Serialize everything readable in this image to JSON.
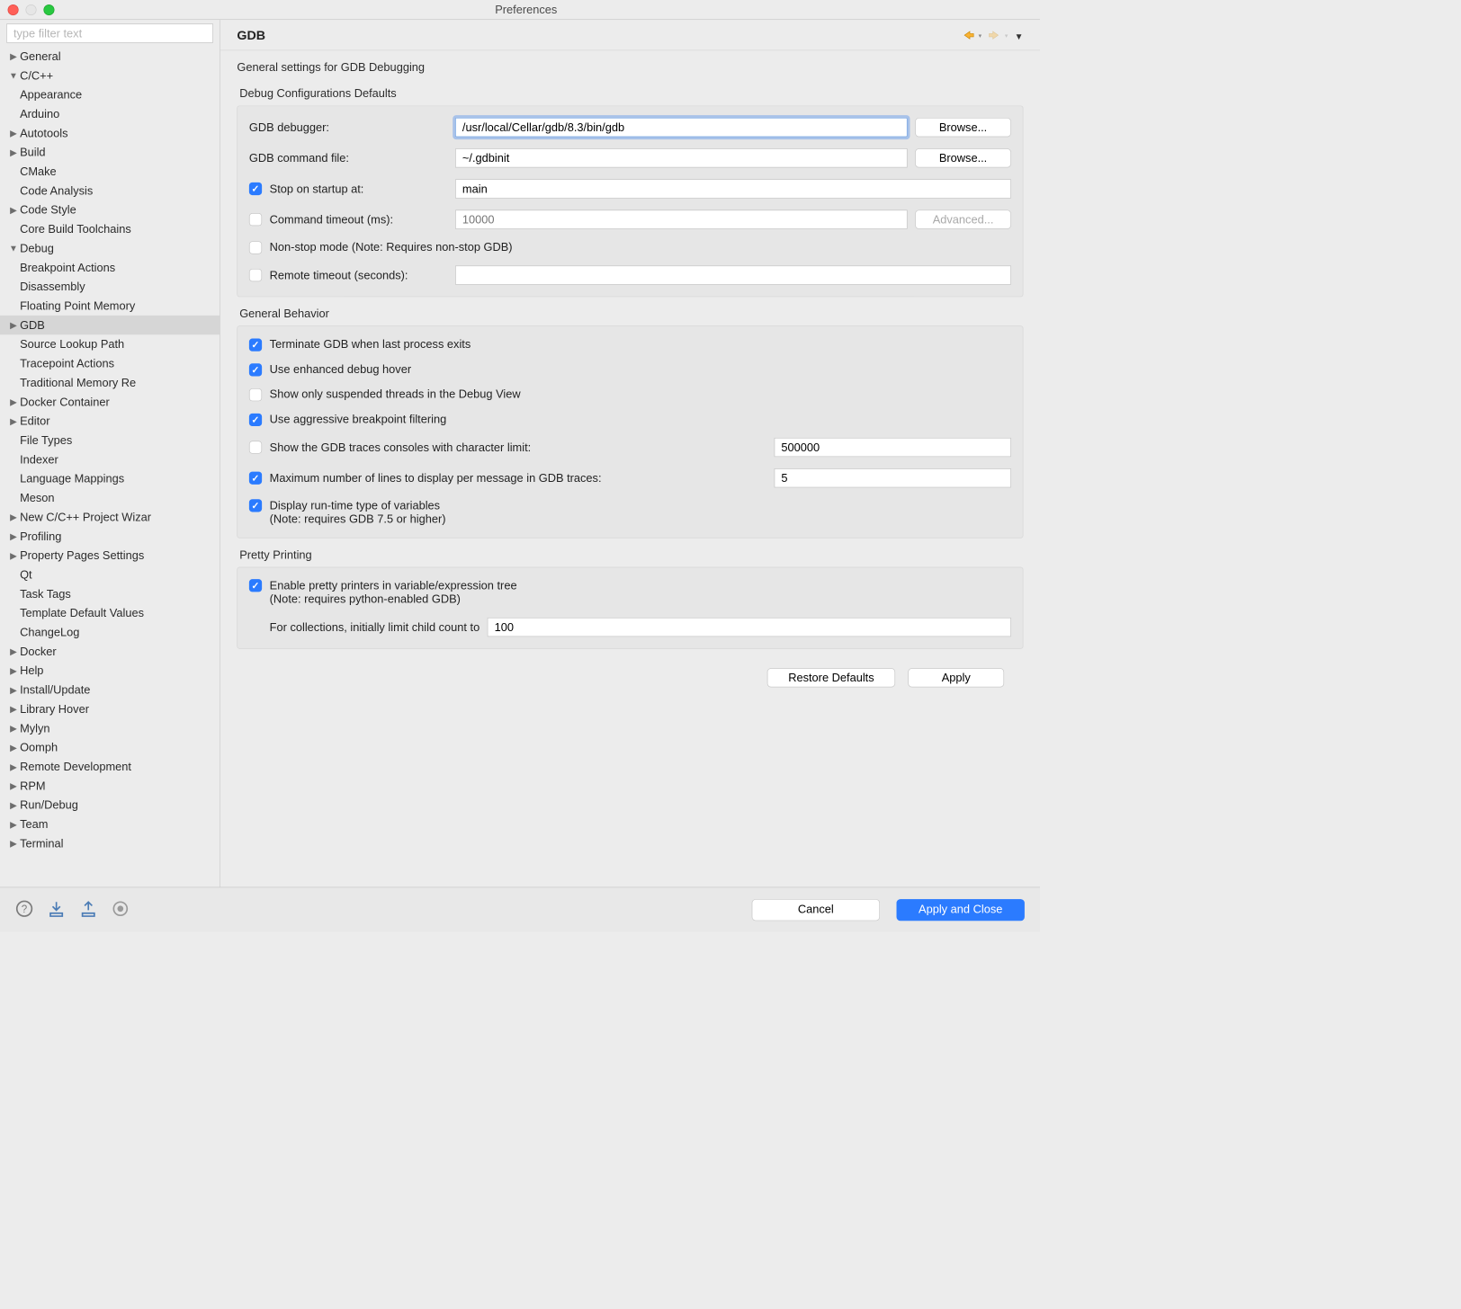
{
  "window_title": "Preferences",
  "filter_placeholder": "type filter text",
  "sidebar": {
    "items": [
      {
        "label": "General",
        "depth": 0,
        "arrow": "right"
      },
      {
        "label": "C/C++",
        "depth": 0,
        "arrow": "down"
      },
      {
        "label": "Appearance",
        "depth": 1,
        "arrow": "none"
      },
      {
        "label": "Arduino",
        "depth": 1,
        "arrow": "none"
      },
      {
        "label": "Autotools",
        "depth": 1,
        "arrow": "right"
      },
      {
        "label": "Build",
        "depth": 1,
        "arrow": "right"
      },
      {
        "label": "CMake",
        "depth": 1,
        "arrow": "none"
      },
      {
        "label": "Code Analysis",
        "depth": 1,
        "arrow": "none"
      },
      {
        "label": "Code Style",
        "depth": 1,
        "arrow": "right"
      },
      {
        "label": "Core Build Toolchains",
        "depth": 1,
        "arrow": "none"
      },
      {
        "label": "Debug",
        "depth": 1,
        "arrow": "down"
      },
      {
        "label": "Breakpoint Actions",
        "depth": 2,
        "arrow": "none"
      },
      {
        "label": "Disassembly",
        "depth": 2,
        "arrow": "none"
      },
      {
        "label": "Floating Point Memory",
        "depth": 2,
        "arrow": "none"
      },
      {
        "label": "GDB",
        "depth": 2,
        "arrow": "right",
        "selected": true
      },
      {
        "label": "Source Lookup Path",
        "depth": 2,
        "arrow": "none"
      },
      {
        "label": "Tracepoint Actions",
        "depth": 2,
        "arrow": "none"
      },
      {
        "label": "Traditional Memory Re",
        "depth": 2,
        "arrow": "none"
      },
      {
        "label": "Docker Container",
        "depth": 1,
        "arrow": "right"
      },
      {
        "label": "Editor",
        "depth": 1,
        "arrow": "right"
      },
      {
        "label": "File Types",
        "depth": 1,
        "arrow": "none"
      },
      {
        "label": "Indexer",
        "depth": 1,
        "arrow": "none"
      },
      {
        "label": "Language Mappings",
        "depth": 1,
        "arrow": "none"
      },
      {
        "label": "Meson",
        "depth": 1,
        "arrow": "none"
      },
      {
        "label": "New C/C++ Project Wizar",
        "depth": 1,
        "arrow": "right"
      },
      {
        "label": "Profiling",
        "depth": 1,
        "arrow": "right"
      },
      {
        "label": "Property Pages Settings",
        "depth": 1,
        "arrow": "right"
      },
      {
        "label": "Qt",
        "depth": 1,
        "arrow": "none"
      },
      {
        "label": "Task Tags",
        "depth": 1,
        "arrow": "none"
      },
      {
        "label": "Template Default Values",
        "depth": 1,
        "arrow": "none"
      },
      {
        "label": "ChangeLog",
        "depth": 0,
        "arrow": "none"
      },
      {
        "label": "Docker",
        "depth": 0,
        "arrow": "right"
      },
      {
        "label": "Help",
        "depth": 0,
        "arrow": "right"
      },
      {
        "label": "Install/Update",
        "depth": 0,
        "arrow": "right"
      },
      {
        "label": "Library Hover",
        "depth": 0,
        "arrow": "right"
      },
      {
        "label": "Mylyn",
        "depth": 0,
        "arrow": "right"
      },
      {
        "label": "Oomph",
        "depth": 0,
        "arrow": "right"
      },
      {
        "label": "Remote Development",
        "depth": 0,
        "arrow": "right"
      },
      {
        "label": "RPM",
        "depth": 0,
        "arrow": "right"
      },
      {
        "label": "Run/Debug",
        "depth": 0,
        "arrow": "right"
      },
      {
        "label": "Team",
        "depth": 0,
        "arrow": "right"
      },
      {
        "label": "Terminal",
        "depth": 0,
        "arrow": "right"
      }
    ]
  },
  "page": {
    "title": "GDB",
    "description": "General settings for GDB Debugging",
    "debug_group_title": "Debug Configurations Defaults",
    "gbehavior_title": "General Behavior",
    "pretty_title": "Pretty Printing",
    "labels": {
      "gdb_debugger": "GDB debugger:",
      "gdb_command_file": "GDB command file:",
      "stop_on_startup": "Stop on startup at:",
      "command_timeout": "Command timeout (ms):",
      "nonstop": "Non-stop mode (Note: Requires non-stop GDB)",
      "remote_timeout": "Remote timeout (seconds):",
      "terminate": "Terminate GDB when last process exits",
      "enhanced_hover": "Use enhanced debug hover",
      "show_suspended": "Show only suspended threads in the Debug View",
      "aggressive": "Use aggressive breakpoint filtering",
      "traces_limit": "Show the GDB traces consoles with character limit:",
      "max_lines": "Maximum number of lines to display per message in GDB traces:",
      "display_rtt": "Display run-time type of variables",
      "display_rtt_note": "(Note: requires GDB 7.5 or higher)",
      "pretty_enable": "Enable pretty printers in variable/expression tree",
      "pretty_enable_note": "(Note: requires python-enabled GDB)",
      "pretty_child": "For collections, initially limit child count to"
    },
    "values": {
      "gdb_debugger": "/usr/local/Cellar/gdb/8.3/bin/gdb",
      "gdb_command_file": "~/.gdbinit",
      "stop_on_startup": "main",
      "command_timeout_placeholder": "10000",
      "traces_limit": "500000",
      "max_lines": "5",
      "pretty_child": "100"
    },
    "buttons": {
      "browse": "Browse...",
      "advanced": "Advanced...",
      "restore": "Restore Defaults",
      "apply": "Apply",
      "cancel": "Cancel",
      "apply_close": "Apply and Close"
    }
  }
}
